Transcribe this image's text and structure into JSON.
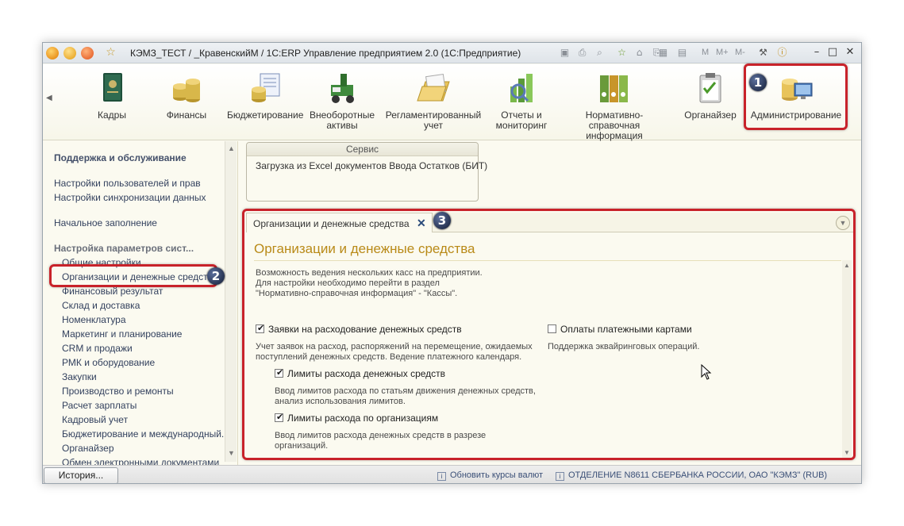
{
  "window": {
    "title": "КЭМЗ_ТЕСТ / _КравенскийМ / 1С:ERP Управление предприятием 2.0  (1С:Предприятие)",
    "toolbar_labels": [
      "M",
      "M+",
      "M-"
    ]
  },
  "sections": [
    {
      "label": "Кадры",
      "icon": "personnel-book-icon"
    },
    {
      "label": "Финансы",
      "icon": "coins-icon"
    },
    {
      "label": "Бюджетирование",
      "icon": "budget-icon"
    },
    {
      "label": "Внеоборотные активы",
      "icon": "assets-icon"
    },
    {
      "label": "Регламентированный учет",
      "icon": "accounting-folder-icon"
    },
    {
      "label": "Отчеты и мониторинг",
      "icon": "reports-chart-icon"
    },
    {
      "label": "Нормативно-справочная информация",
      "icon": "binders-icon"
    },
    {
      "label": "Органайзер",
      "icon": "organizer-clipboard-icon"
    },
    {
      "label": "Администрирование",
      "icon": "admin-computer-icon"
    }
  ],
  "nav": {
    "heading1": "Поддержка и обслуживание",
    "items1": [
      "Настройки пользователей и прав",
      "Настройки синхронизации данных"
    ],
    "item_initial": "Начальное заполнение",
    "heading2": "Настройка параметров сист...",
    "items2": [
      "Общие настройки",
      "Организации и денежные средства",
      "Финансовый результат",
      "Склад и доставка",
      "Номенклатура",
      "Маркетинг и планирование",
      "CRM и продажи",
      "РМК и оборудование",
      "Закупки",
      "Производство и ремонты",
      "Расчет зарплаты",
      "Кадровый учет",
      "Бюджетирование и международный...",
      "Органайзер",
      "Обмен электронными документами"
    ]
  },
  "service": {
    "title": "Сервис",
    "link": "Загрузка из Excel документов Ввода Остатков (БИТ)"
  },
  "form": {
    "tab_label": "Организации и денежные средства",
    "title": "Организации и денежные средства",
    "intro": [
      "Возможность ведения нескольких касс на предприятии.",
      "Для настройки необходимо перейти в раздел",
      "\"Нормативно-справочная информация\" - \"Кассы\"."
    ],
    "chk_requests": "Заявки на расходование денежных средств",
    "chk_requests_checked": true,
    "requests_desc": [
      "Учет заявок на расход, распоряжений на перемещение, ожидаемых",
      "поступлений денежных средств. Ведение платежного календаря."
    ],
    "chk_limits": "Лимиты расхода денежных средств",
    "chk_limits_checked": true,
    "limits_desc": [
      "Ввод лимитов расхода по статьям движения денежных средств,",
      "анализ использования лимитов."
    ],
    "chk_org_limits": "Лимиты расхода по организациям",
    "chk_org_limits_checked": true,
    "org_limits_desc": [
      "Ввод лимитов расхода денежных средств в разрезе",
      "организаций."
    ],
    "chk_cards": "Оплаты платежными картами",
    "chk_cards_checked": false,
    "cards_desc": "Поддержка эквайринговых операций."
  },
  "bottom": {
    "history": "История...",
    "status1": "Обновить курсы валют",
    "status2": "ОТДЕЛЕНИЕ N8611 СБЕРБАНКА РОССИИ, ОАО \"КЭМЗ\" (RUB)"
  },
  "badges": [
    "1",
    "2",
    "3"
  ],
  "colors": {
    "accent_red": "#c8222a",
    "title_gold": "#b98a18",
    "nav_text": "#33415e"
  }
}
